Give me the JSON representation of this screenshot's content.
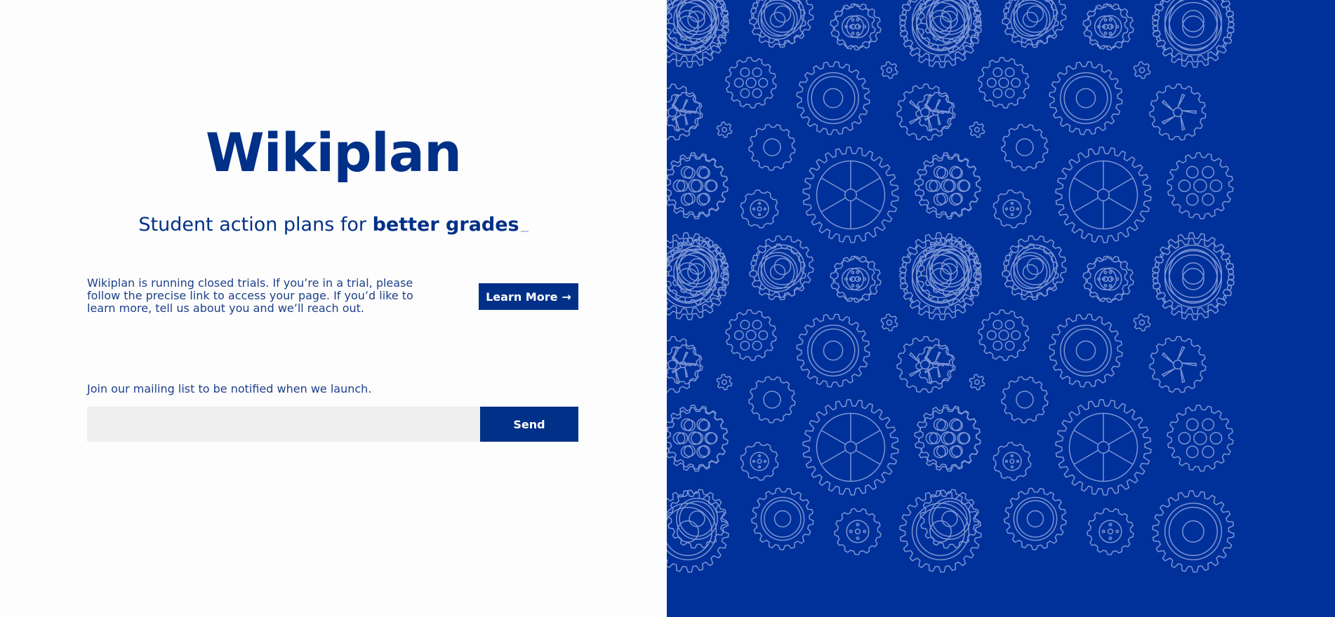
{
  "brand": {
    "name": "Wikiplan"
  },
  "tagline": {
    "prefix": "Student action plans for ",
    "emphasis": "better grades"
  },
  "info": {
    "text": "Wikiplan is running closed trials. If you’re in a trial, please follow the precise link to access your page. If you’d like to learn more, tell us about you and we’ll reach out.",
    "button_label": "Learn More",
    "button_icon": "arrow-right-icon",
    "button_glyph": "→"
  },
  "mailing": {
    "label": "Join our mailing list to be notified when we launch.",
    "input_value": "",
    "input_placeholder": "",
    "send_label": "Send"
  },
  "colors": {
    "primary": "#003087",
    "pattern_background": "#00309a",
    "pattern_stroke": "#7b95d4",
    "input_background": "#efefef"
  }
}
